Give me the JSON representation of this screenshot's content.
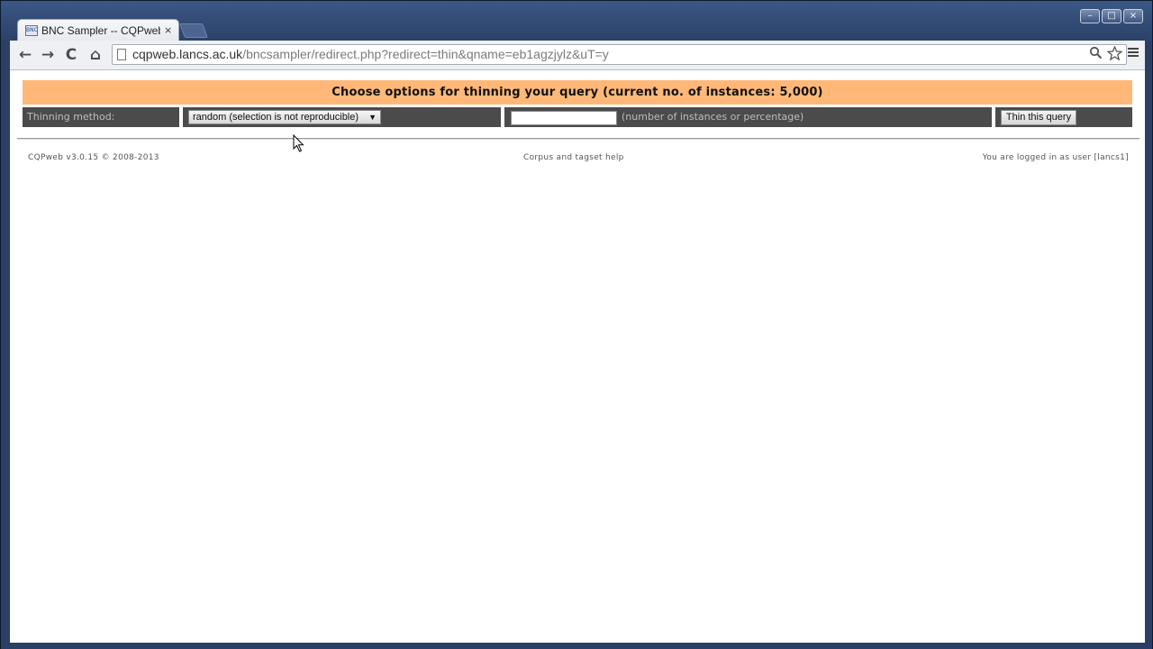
{
  "browser": {
    "tab": {
      "title": "BNC Sampler -- CQPweb T",
      "favicon_text": "BNC",
      "close_glyph": "×"
    },
    "window_controls": {
      "minimize": "–",
      "maximize": "□",
      "close": "×"
    },
    "nav": {
      "back": "←",
      "forward": "→",
      "reload": "C",
      "home": "⌂"
    },
    "url_host": "cqpweb.lancs.ac.uk",
    "url_rest": "/bncsampler/redirect.php?redirect=thin&qname=eb1agzjylz&uT=y",
    "icons": {
      "zoom": "search-icon",
      "bookmark": "star-icon",
      "menu": "hamburger-menu-icon"
    }
  },
  "page": {
    "header": "Choose options for thinning your query (current no. of instances: 5,000)",
    "thinning_label": "Thinning method:",
    "method_select": {
      "selected": "random (selection is not reproducible)"
    },
    "count_input": {
      "value": "",
      "hint": "(number of instances or percentage)"
    },
    "submit_label": "Thin this query",
    "footer": {
      "version": "CQPweb v3.0.15 © 2008-2013",
      "help_link": "Corpus and tagset help",
      "login_status": "You are logged in as user [lancs1]"
    }
  },
  "colors": {
    "header_bg": "#ffb877",
    "row_bg": "#4b4b4b",
    "window_frame": "#2a3f63"
  }
}
